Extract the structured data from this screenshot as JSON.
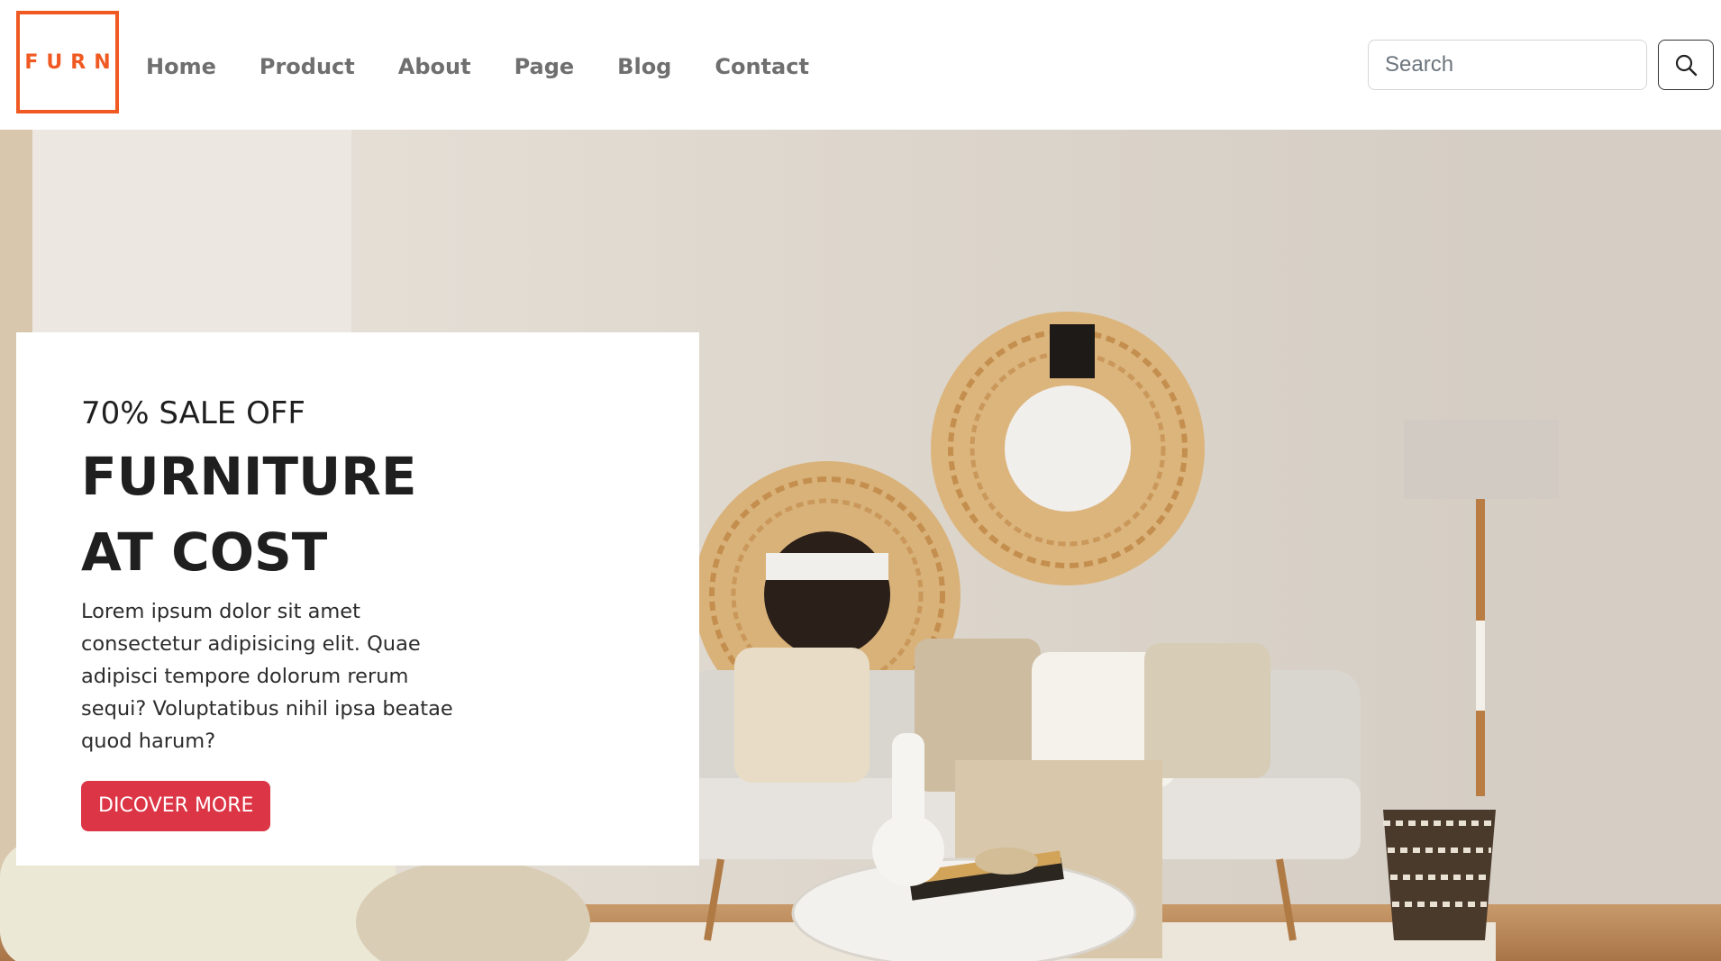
{
  "brand": {
    "logo_text": "FURN",
    "accent_color": "#f05a22"
  },
  "nav": {
    "items": [
      {
        "label": "Home"
      },
      {
        "label": "Product"
      },
      {
        "label": "About"
      },
      {
        "label": "Page"
      },
      {
        "label": "Blog"
      },
      {
        "label": "Contact"
      }
    ]
  },
  "search": {
    "placeholder": "Search",
    "button_icon": "search-icon"
  },
  "hero": {
    "eyebrow": "70% SALE OFF",
    "headline_line1": "FURNITURE",
    "headline_line2": "AT COST",
    "description": "Lorem ipsum dolor sit amet consectetur adipisicing elit. Quae adipisci tempore dolorum rerum sequi? Voluptatibus nihil ipsa beatae quod harum?",
    "cta_label": "DICOVER MORE",
    "cta_color": "#dc3545"
  }
}
